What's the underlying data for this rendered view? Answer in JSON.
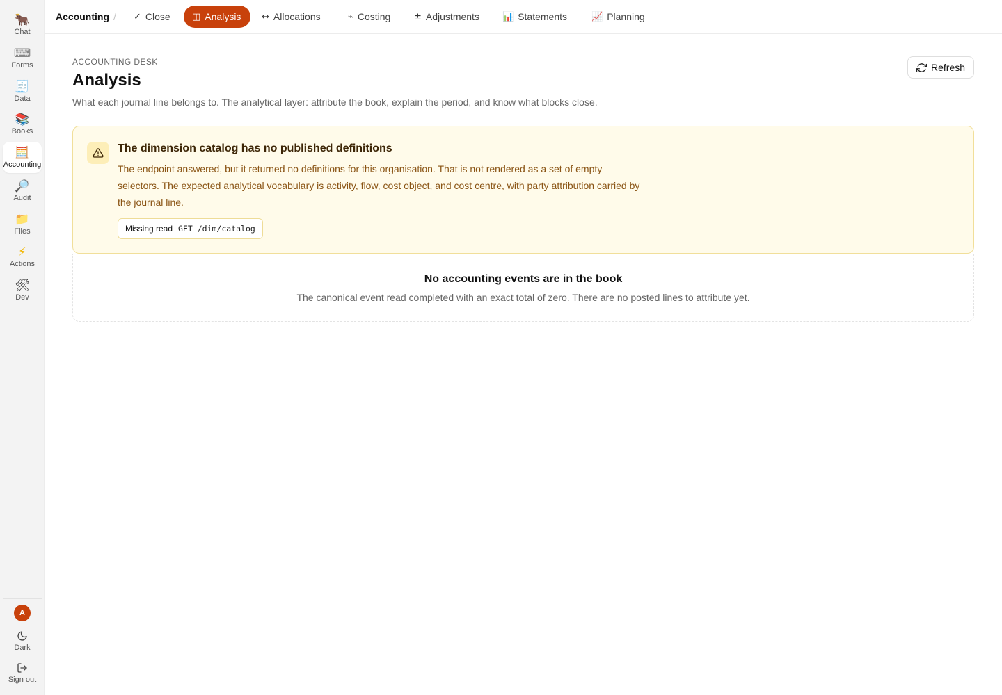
{
  "sidebar": {
    "items": [
      {
        "label": "Chat",
        "icon": "🐂",
        "icon_name": "ox-icon"
      },
      {
        "label": "Forms",
        "icon": "⌨",
        "icon_name": "keyboard-icon"
      },
      {
        "label": "Data",
        "icon": "🧾",
        "icon_name": "receipt-icon"
      },
      {
        "label": "Books",
        "icon": "📚",
        "icon_name": "books-icon"
      },
      {
        "label": "Accounting",
        "icon": "🧮",
        "icon_name": "abacus-icon",
        "active": true
      },
      {
        "label": "Audit",
        "icon": "🔎",
        "icon_name": "magnifier-icon"
      },
      {
        "label": "Files",
        "icon": "📁",
        "icon_name": "folder-icon"
      },
      {
        "label": "Actions",
        "icon": "⚡",
        "icon_name": "lightning-icon"
      },
      {
        "label": "Dev",
        "icon": "🛠",
        "icon_name": "tools-icon"
      }
    ],
    "avatar_initial": "A",
    "theme_label": "Dark",
    "signout_label": "Sign out"
  },
  "topbar": {
    "breadcrumb": "Accounting",
    "separator": "/",
    "tabs": [
      {
        "glyph": "✓",
        "label": "Close"
      },
      {
        "glyph": "◫",
        "label": "Analysis",
        "active": true
      },
      {
        "glyph": "↔",
        "label": "Allocations"
      },
      {
        "glyph": "⌁",
        "label": "Costing"
      },
      {
        "glyph": "±",
        "label": "Adjustments"
      },
      {
        "glyph": "📊",
        "label": "Statements"
      },
      {
        "glyph": "📈",
        "label": "Planning"
      }
    ]
  },
  "header": {
    "eyebrow": "ACCOUNTING DESK",
    "title": "Analysis",
    "description": "What each journal line belongs to. The analytical layer: attribute the book, explain the period, and know what blocks close.",
    "refresh_label": "Refresh"
  },
  "alert": {
    "title": "The dimension catalog has no published definitions",
    "body": "The endpoint answered, but it returned no definitions for this organisation. That is not rendered as a set of empty selectors. The expected analytical vocabulary is activity, flow, cost object, and cost centre, with party attribution carried by the journal line.",
    "chip_label": "Missing read",
    "chip_code": "GET /dim/catalog"
  },
  "empty_state": {
    "title": "No accounting events are in the book",
    "description": "The canonical event read completed with an exact total of zero. There are no posted lines to attribute yet."
  },
  "colors": {
    "accent": "#c8410b",
    "warning_bg": "#fffbea",
    "warning_border": "#f1df9a",
    "warning_text": "#8a5414"
  }
}
